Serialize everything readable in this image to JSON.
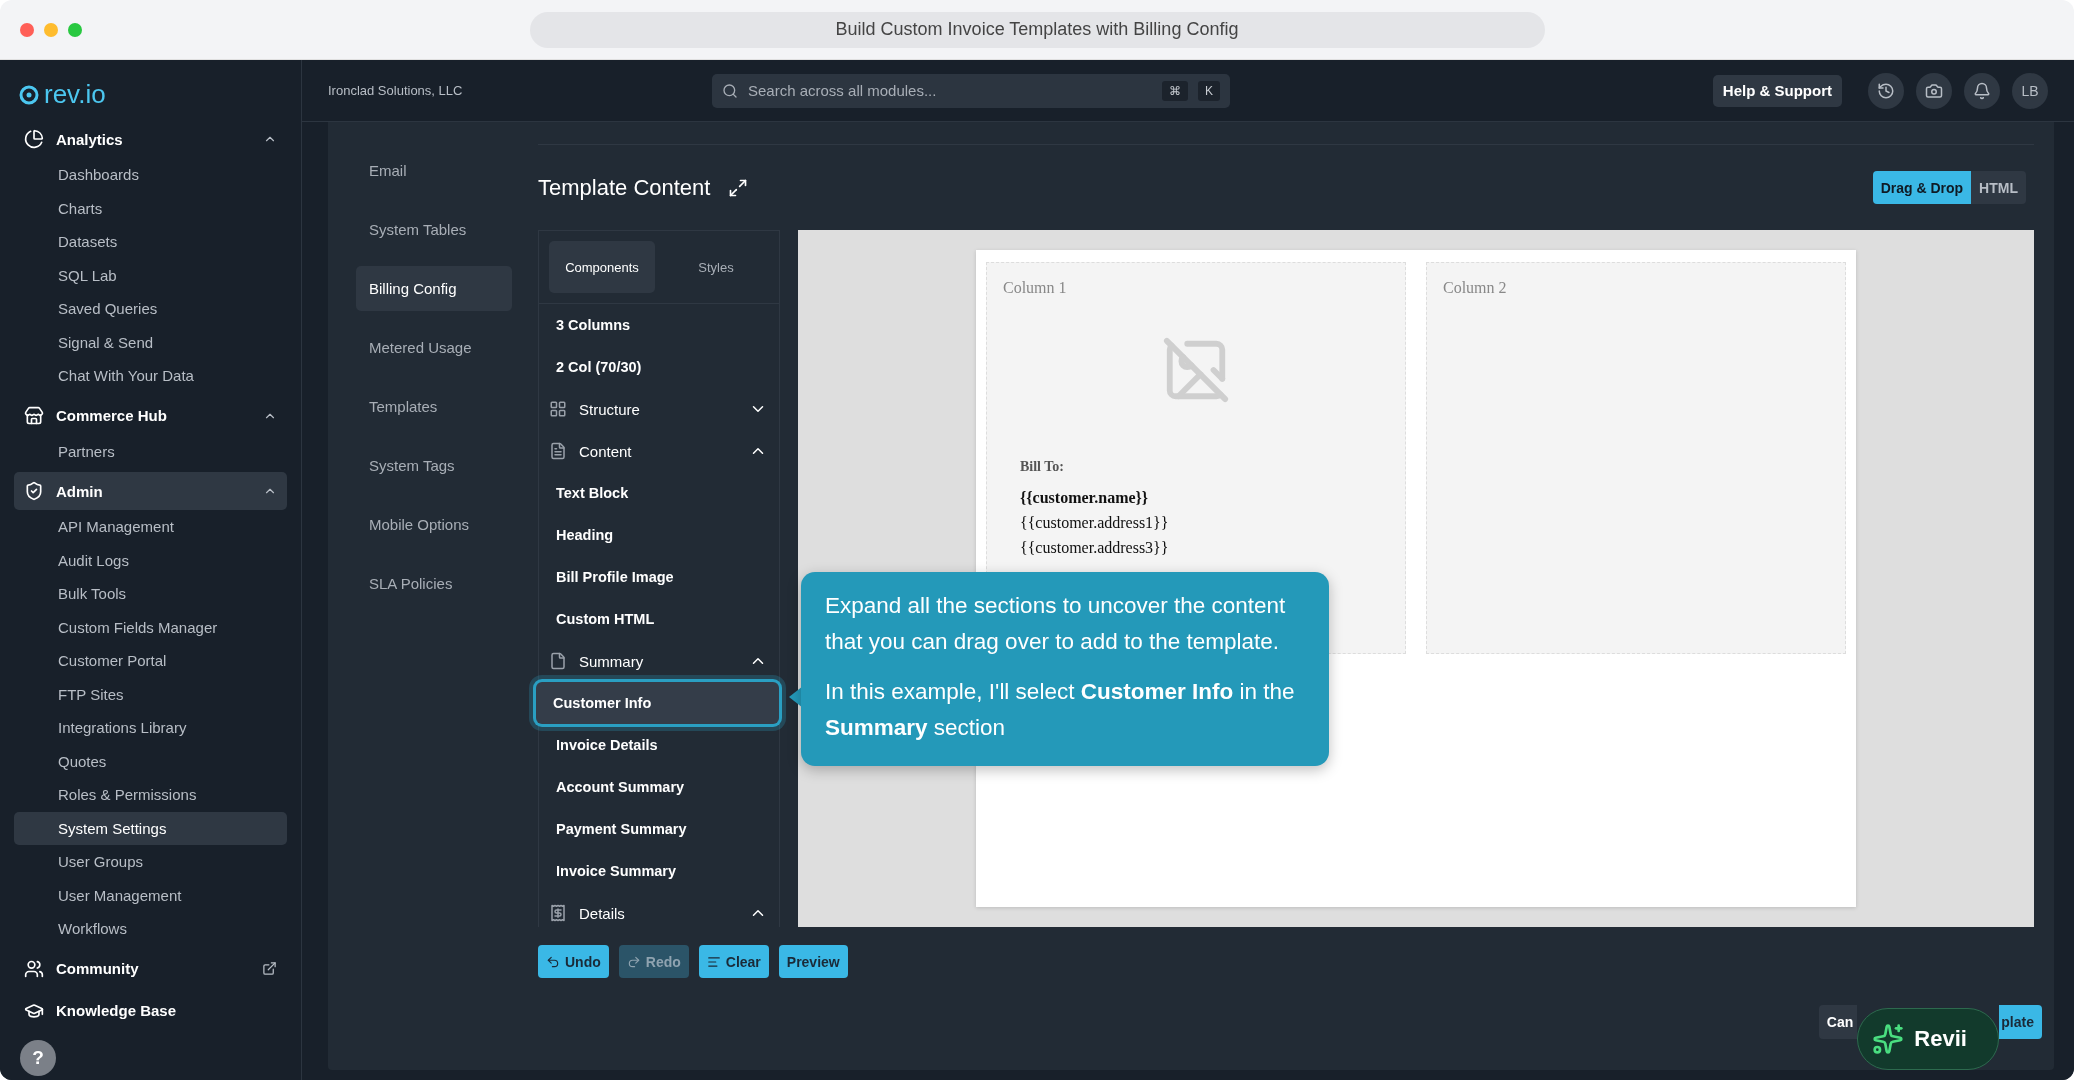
{
  "window": {
    "title": "Build Custom Invoice Templates with Billing Config"
  },
  "sidebar": {
    "logo": "rev.io",
    "groups": [
      {
        "label": "Analytics",
        "expanded": true,
        "selected": false,
        "items": [
          {
            "label": "Dashboards",
            "selected": false
          },
          {
            "label": "Charts",
            "selected": false
          },
          {
            "label": "Datasets",
            "selected": false
          },
          {
            "label": "SQL Lab",
            "selected": false
          },
          {
            "label": "Saved Queries",
            "selected": false
          },
          {
            "label": "Signal & Send",
            "selected": false
          },
          {
            "label": "Chat With Your Data",
            "selected": false
          }
        ]
      },
      {
        "label": "Commerce Hub",
        "expanded": true,
        "selected": false,
        "items": [
          {
            "label": "Partners",
            "selected": false
          }
        ]
      },
      {
        "label": "Admin",
        "expanded": true,
        "selected": true,
        "items": [
          {
            "label": "API Management",
            "selected": false
          },
          {
            "label": "Audit Logs",
            "selected": false
          },
          {
            "label": "Bulk Tools",
            "selected": false
          },
          {
            "label": "Custom Fields Manager",
            "selected": false
          },
          {
            "label": "Customer Portal",
            "selected": false
          },
          {
            "label": "FTP Sites",
            "selected": false
          },
          {
            "label": "Integrations Library",
            "selected": false
          },
          {
            "label": "Quotes",
            "selected": false
          },
          {
            "label": "Roles & Permissions",
            "selected": false
          },
          {
            "label": "System Settings",
            "selected": true
          },
          {
            "label": "User Groups",
            "selected": false
          },
          {
            "label": "User Management",
            "selected": false
          },
          {
            "label": "Workflows",
            "selected": false
          }
        ]
      },
      {
        "label": "Community",
        "expanded": false,
        "selected": false
      },
      {
        "label": "Knowledge Base",
        "expanded": false,
        "selected": false
      }
    ],
    "help": "?"
  },
  "topbar": {
    "org": "Ironclad Solutions, LLC",
    "search": {
      "placeholder": "Search across all modules...",
      "keys": [
        "⌘",
        "K"
      ]
    },
    "help_button": "Help & Support",
    "avatar": "LB"
  },
  "subnav": [
    {
      "label": "Email",
      "selected": false
    },
    {
      "label": "System Tables",
      "selected": false
    },
    {
      "label": "Billing Config",
      "selected": true
    },
    {
      "label": "Metered Usage",
      "selected": false
    },
    {
      "label": "Templates",
      "selected": false
    },
    {
      "label": "System Tags",
      "selected": false
    },
    {
      "label": "Mobile Options",
      "selected": false
    },
    {
      "label": "SLA Policies",
      "selected": false
    }
  ],
  "editor": {
    "title": "Template Content",
    "modes": [
      {
        "label": "Drag & Drop",
        "selected": true
      },
      {
        "label": "HTML",
        "selected": false
      }
    ],
    "panel_tabs": [
      {
        "label": "Components",
        "selected": true
      },
      {
        "label": "Styles",
        "selected": false
      }
    ],
    "components": [
      {
        "kind": "item",
        "label": "3 Columns",
        "selected": false
      },
      {
        "kind": "item",
        "label": "2 Col (70/30)",
        "selected": false
      },
      {
        "kind": "section",
        "label": "Structure",
        "expanded": false
      },
      {
        "kind": "section",
        "label": "Content",
        "expanded": true
      },
      {
        "kind": "item",
        "label": "Text Block",
        "selected": false
      },
      {
        "kind": "item",
        "label": "Heading",
        "selected": false
      },
      {
        "kind": "item",
        "label": "Bill Profile Image",
        "selected": false
      },
      {
        "kind": "item",
        "label": "Custom HTML",
        "selected": false
      },
      {
        "kind": "section",
        "label": "Summary",
        "expanded": true
      },
      {
        "kind": "item",
        "label": "Customer Info",
        "selected": true
      },
      {
        "kind": "item",
        "label": "Invoice Details",
        "selected": false
      },
      {
        "kind": "item",
        "label": "Account Summary",
        "selected": false
      },
      {
        "kind": "item",
        "label": "Payment Summary",
        "selected": false
      },
      {
        "kind": "item",
        "label": "Invoice Summary",
        "selected": false
      },
      {
        "kind": "section",
        "label": "Details",
        "expanded": true
      }
    ],
    "columns": [
      {
        "label": "Column 1",
        "bill_to": "Bill To:",
        "lines": [
          {
            "text": "{{customer.name}}",
            "bold": true
          },
          {
            "text": "{{customer.address1}}",
            "bold": false
          },
          {
            "text": "{{customer.address3}}",
            "bold": false
          }
        ]
      },
      {
        "label": "Column 2"
      }
    ],
    "actions": [
      {
        "label": "Undo",
        "disabled": false
      },
      {
        "label": "Redo",
        "disabled": true
      },
      {
        "label": "Clear",
        "disabled": false
      },
      {
        "label": "Preview",
        "disabled": false
      }
    ],
    "footer": {
      "cancel": "Can",
      "save": "plate"
    }
  },
  "tooltip": {
    "paragraphs": [
      "Expand all the sections to uncover the content that you can drag over to add to the template.",
      "In this example, I'll select **Customer Info** in the **Summary** section"
    ]
  },
  "assistant": {
    "label": "Revii"
  }
}
